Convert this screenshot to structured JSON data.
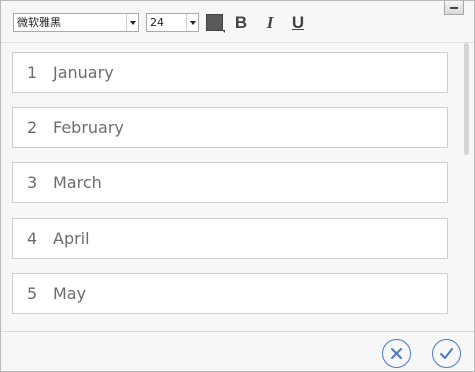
{
  "toolbar": {
    "font_family": "微软雅黑",
    "font_size": "24",
    "text_color": "#5a5a5a",
    "bold_label": "B",
    "italic_label": "I",
    "underline_label": "U"
  },
  "list": {
    "items": [
      {
        "number": "1",
        "label": "January"
      },
      {
        "number": "2",
        "label": "February"
      },
      {
        "number": "3",
        "label": "March"
      },
      {
        "number": "4",
        "label": "April"
      },
      {
        "number": "5",
        "label": "May"
      }
    ]
  },
  "footer": {
    "cancel_icon": "close-icon",
    "confirm_icon": "check-icon",
    "accent_color": "#4f79c3"
  }
}
